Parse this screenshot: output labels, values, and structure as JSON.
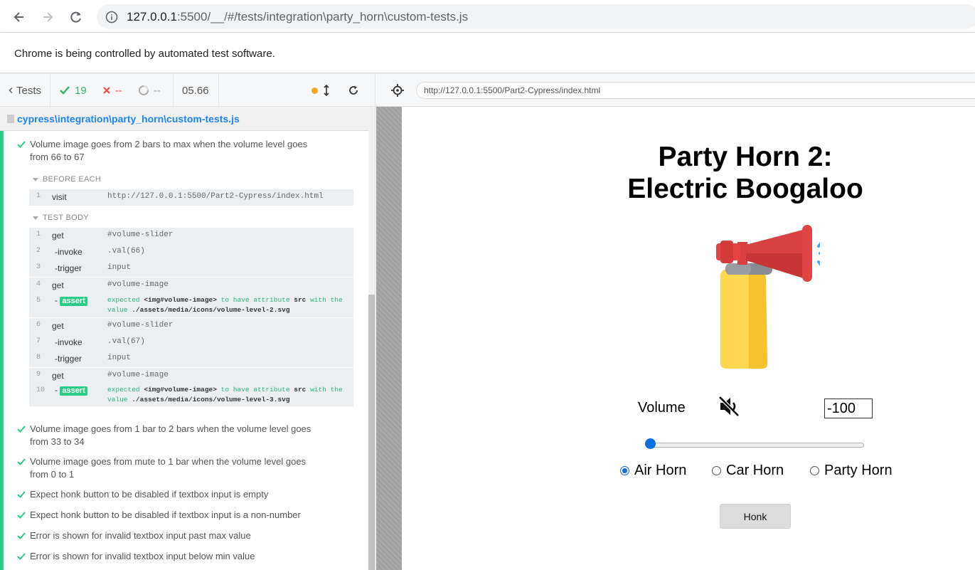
{
  "browser": {
    "url_host": "127.0.0.1",
    "url_rest": ":5500/__/#/tests/integration\\party_horn\\custom-tests.js",
    "infobar": "Chrome is being controlled by automated test software."
  },
  "reporter": {
    "tests_label": "Tests",
    "passed": "19",
    "failed": "--",
    "pending": "--",
    "duration": "05.66",
    "spec_path": "cypress\\integration\\party_horn\\custom-tests.js",
    "expanded_test": {
      "title_line1": "Volume image goes from 2 bars to max when the volume level goes",
      "title_line2": "from 66 to 67",
      "before_each_label": "BEFORE EACH",
      "test_body_label": "TEST BODY",
      "before_each": [
        {
          "num": "1",
          "name": "visit",
          "msg": "http://127.0.0.1:5500/Part2-Cypress/index.html"
        }
      ],
      "commands": [
        {
          "num": "1",
          "name": "get",
          "msg": "#volume-slider"
        },
        {
          "num": "2",
          "name": "-invoke",
          "msg": ".val(66)"
        },
        {
          "num": "3",
          "name": "-trigger",
          "msg": "input"
        },
        {
          "num": "4",
          "name": "get",
          "msg": "#volume-image"
        },
        {
          "num": "5",
          "name": "assert",
          "line1_pre": "expected ",
          "line1_el": "<img#volume-image>",
          "line1_mid": " to have attribute ",
          "line1_attr": "src",
          "line1_post": " with the",
          "line2_pre": "value ",
          "line2_val": "./assets/media/icons/volume-level-2.svg"
        },
        {
          "num": "6",
          "name": "get",
          "msg": "#volume-slider"
        },
        {
          "num": "7",
          "name": "-invoke",
          "msg": ".val(67)"
        },
        {
          "num": "8",
          "name": "-trigger",
          "msg": "input"
        },
        {
          "num": "9",
          "name": "get",
          "msg": "#volume-image"
        },
        {
          "num": "10",
          "name": "assert",
          "line1_pre": "expected ",
          "line1_el": "<img#volume-image>",
          "line1_mid": " to have attribute ",
          "line1_attr": "src",
          "line1_post": " with the",
          "line2_pre": "value ",
          "line2_val": "./assets/media/icons/volume-level-3.svg"
        }
      ]
    },
    "other_tests": [
      {
        "line1": "Volume image goes from 1 bar to 2 bars when the volume level goes",
        "line2": "from 33 to 34"
      },
      {
        "line1": "Volume image goes from mute to 1 bar when the volume level goes",
        "line2": "from 0 to 1"
      },
      {
        "line1": "Expect honk button to be disabled if textbox input is empty",
        "line2": ""
      },
      {
        "line1": "Expect honk button to be disabled if textbox input is a non-number",
        "line2": ""
      },
      {
        "line1": "Error is shown for invalid textbox input past max value",
        "line2": ""
      },
      {
        "line1": "Error is shown for invalid textbox input below min value",
        "line2": ""
      }
    ]
  },
  "aut": {
    "url": "http://127.0.0.1:5500/Part2-Cypress/index.html",
    "title_line1": "Party Horn 2:",
    "title_line2": "Electric Boogaloo",
    "volume_label": "Volume",
    "volume_value": "-100",
    "slider_fraction": 0,
    "radios": [
      {
        "label": "Air Horn",
        "checked": true
      },
      {
        "label": "Car Horn",
        "checked": false
      },
      {
        "label": "Party Horn",
        "checked": false
      }
    ],
    "honk_label": "Honk"
  },
  "colors": {
    "pass": "#3cb371",
    "fail": "#e94f4f",
    "accent": "#0b6fe0",
    "assert": "#2bcc87"
  }
}
